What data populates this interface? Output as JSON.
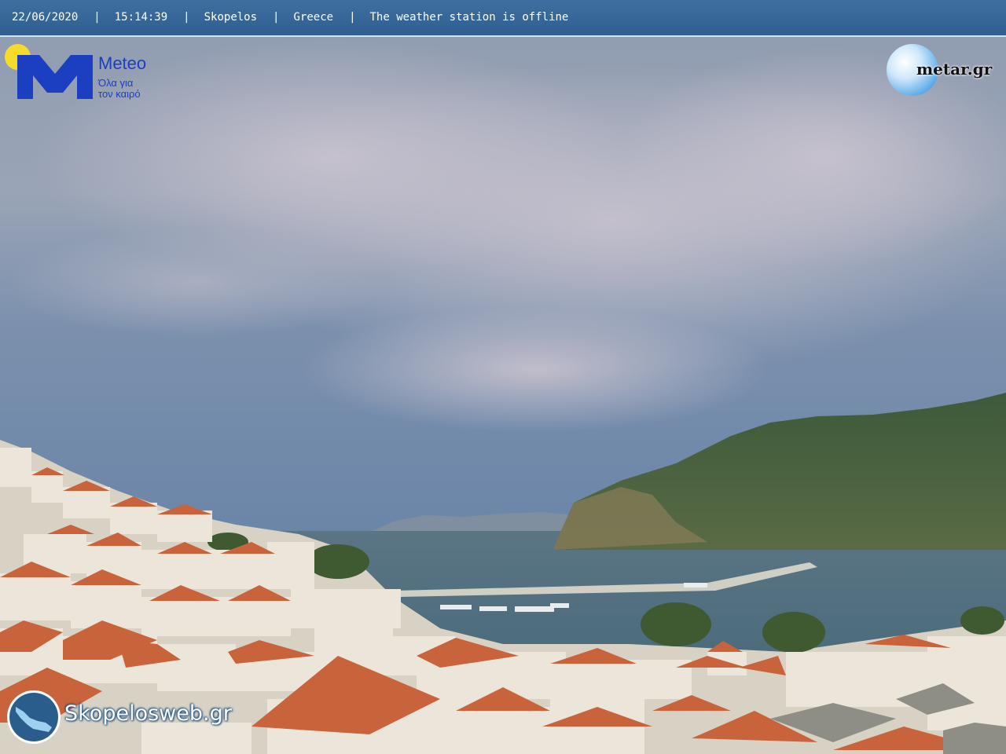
{
  "topbar": {
    "date": "22/06/2020",
    "time": "15:14:39",
    "location": "Skopelos",
    "country": "Greece",
    "status": "The weather station is offline",
    "separator": "|"
  },
  "meteo_logo": {
    "name": "Meteo",
    "tagline_line1": "Όλα για",
    "tagline_line2": "τον καιρό",
    "colors": {
      "brand": "#1b3fc0",
      "sun": "#f7db2a"
    }
  },
  "metar_logo": {
    "name": "metar.gr"
  },
  "skopelos_logo": {
    "name": "Skopelosweb.gr"
  },
  "scene": {
    "description_colors": {
      "sky_top": "#8a98ad",
      "sky_bottom": "#6c84a6",
      "sea": "#4c6d7e",
      "hill": "#3f5a37",
      "roof": "#c9643d",
      "wall": "#e8e2d6"
    }
  }
}
